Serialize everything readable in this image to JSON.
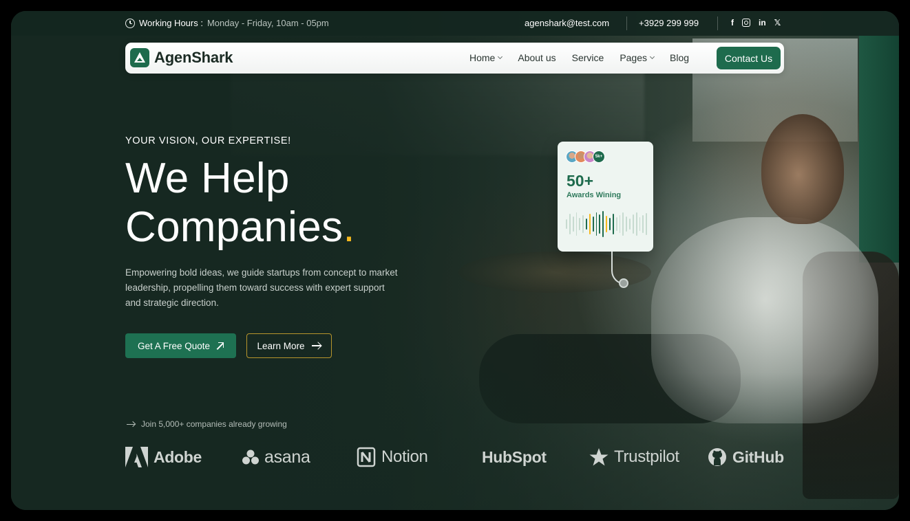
{
  "topbar": {
    "hours_label": "Working Hours :",
    "hours_value": "Monday - Friday, 10am - 05pm",
    "email": "agenshark@test.com",
    "phone": "+3929 299 999",
    "socials": [
      "facebook-icon",
      "instagram-icon",
      "linkedin-icon",
      "x-icon"
    ],
    "social_glyphs": {
      "facebook": "f",
      "linkedin": "in",
      "x": "𝕏"
    }
  },
  "nav": {
    "brand": "AgenShark",
    "links": [
      {
        "label": "Home",
        "dropdown": true
      },
      {
        "label": "About us",
        "dropdown": false
      },
      {
        "label": "Service",
        "dropdown": false
      },
      {
        "label": "Pages",
        "dropdown": true
      },
      {
        "label": "Blog",
        "dropdown": false
      }
    ],
    "cta": "Contact Us"
  },
  "hero": {
    "eyebrow": "YOUR VISION, OUR EXPERTISE!",
    "title_line1": "We Help",
    "title_line2": "Companies",
    "title_dot": ".",
    "description": "Empowering bold ideas, we guide startups from concept to market leadership, propelling them toward success with expert support and strategic direction.",
    "primary_button": "Get A Free Quote",
    "secondary_button": "Learn More"
  },
  "social_proof": {
    "text": "Join 5,000+ companies already growing",
    "brands": [
      "Adobe",
      "asana",
      "Notion",
      "HubSpot",
      "Trustpilot",
      "GitHub"
    ]
  },
  "award_card": {
    "avatar_more": "5k+",
    "number": "50+",
    "label": "Awards Wining"
  },
  "colors": {
    "brand_green": "#1e6b4d",
    "accent_yellow": "#f5b91e",
    "background": "#1c3229"
  }
}
